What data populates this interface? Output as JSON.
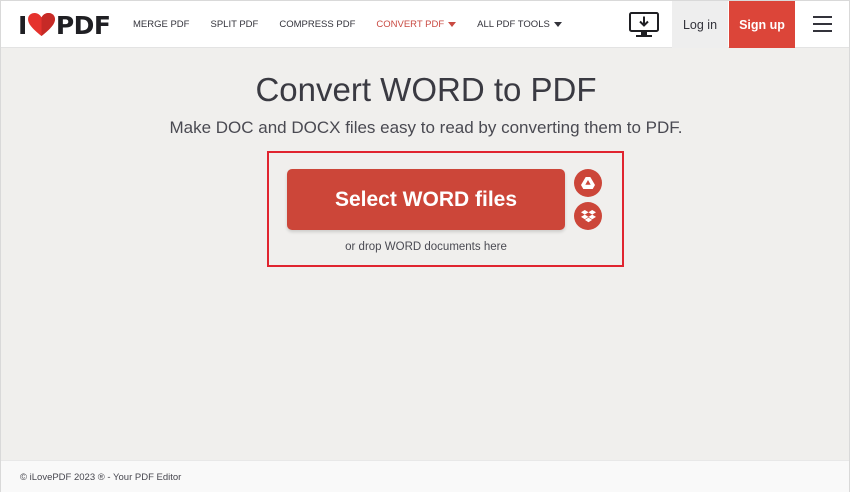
{
  "header": {
    "logo": {
      "left": "I",
      "right": "PDF"
    },
    "nav": [
      {
        "label": "MERGE PDF",
        "active": false,
        "dropdown": false
      },
      {
        "label": "SPLIT PDF",
        "active": false,
        "dropdown": false
      },
      {
        "label": "COMPRESS PDF",
        "active": false,
        "dropdown": false
      },
      {
        "label": "CONVERT PDF",
        "active": true,
        "dropdown": true
      },
      {
        "label": "ALL PDF TOOLS",
        "active": false,
        "dropdown": true
      }
    ],
    "login_label": "Log in",
    "signup_label": "Sign up",
    "icons": {
      "desktop": "desktop-download-icon",
      "menu": "hamburger-menu-icon"
    }
  },
  "main": {
    "title": "Convert WORD to PDF",
    "subtitle": "Make DOC and DOCX files easy to read by converting them to PDF.",
    "select_button_label": "Select WORD files",
    "drop_hint": "or drop WORD documents here",
    "cloud_icons": [
      "google-drive-icon",
      "dropbox-icon"
    ]
  },
  "footer": {
    "copyright": "© iLovePDF 2023 ® - Your PDF Editor"
  },
  "colors": {
    "brand_red": "#cc4639",
    "highlight_red": "#e0242f",
    "active_nav": "#c94a42",
    "background": "#f0efed"
  }
}
